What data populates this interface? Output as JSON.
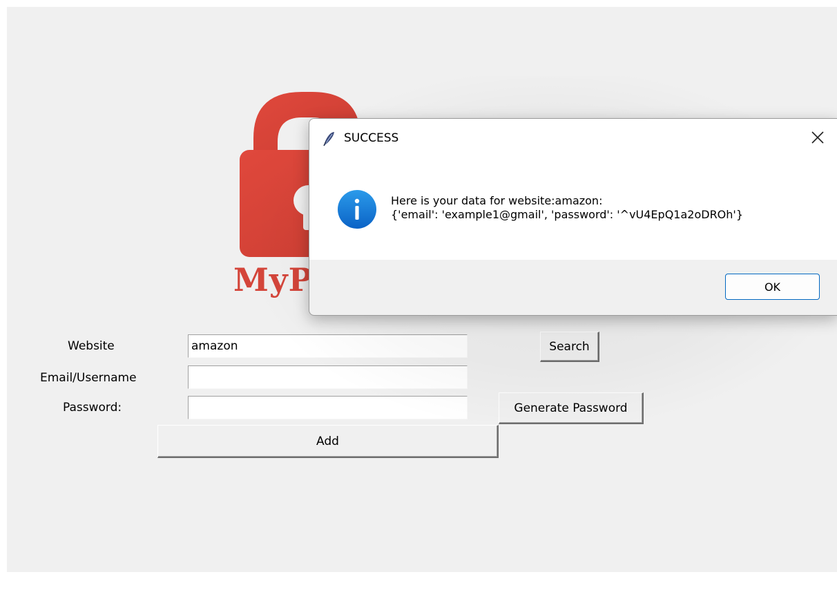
{
  "logo": {
    "text": "MyP",
    "color": "#d4453a"
  },
  "form": {
    "website_label": "Website",
    "website_value": "amazon",
    "email_label": "Email/Username",
    "email_value": "",
    "password_label": "Password:",
    "password_value": "",
    "search_button": "Search",
    "generate_button": "Generate Password",
    "add_button": "Add"
  },
  "dialog": {
    "title": "SUCCESS",
    "title_icon": "feather-icon",
    "icon": "info-icon",
    "message_line1": "Here is your data for website:amazon:",
    "message_line2": "{'email': 'example1@gmail', 'password': '^vU4EpQ1a2oDROh'}",
    "ok_button": "OK",
    "accent": "#0067c0"
  }
}
